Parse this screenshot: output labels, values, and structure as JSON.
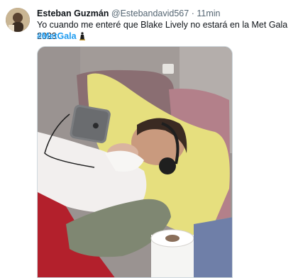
{
  "tweet": {
    "author_name": "Esteban Guzmán",
    "handle": "@Estebandavid567",
    "separator": "·",
    "time": "11min",
    "text": "Yo cuando me enteré que Blake Lively no estará en la Met Gala 2023",
    "hashtag": "#MetGala",
    "hashtag_icon": "met-gala-staircase-icon"
  },
  "colors": {
    "text": "#0f1419",
    "secondary": "#536471",
    "link": "#1d9bf0",
    "border": "#cfd9de"
  }
}
